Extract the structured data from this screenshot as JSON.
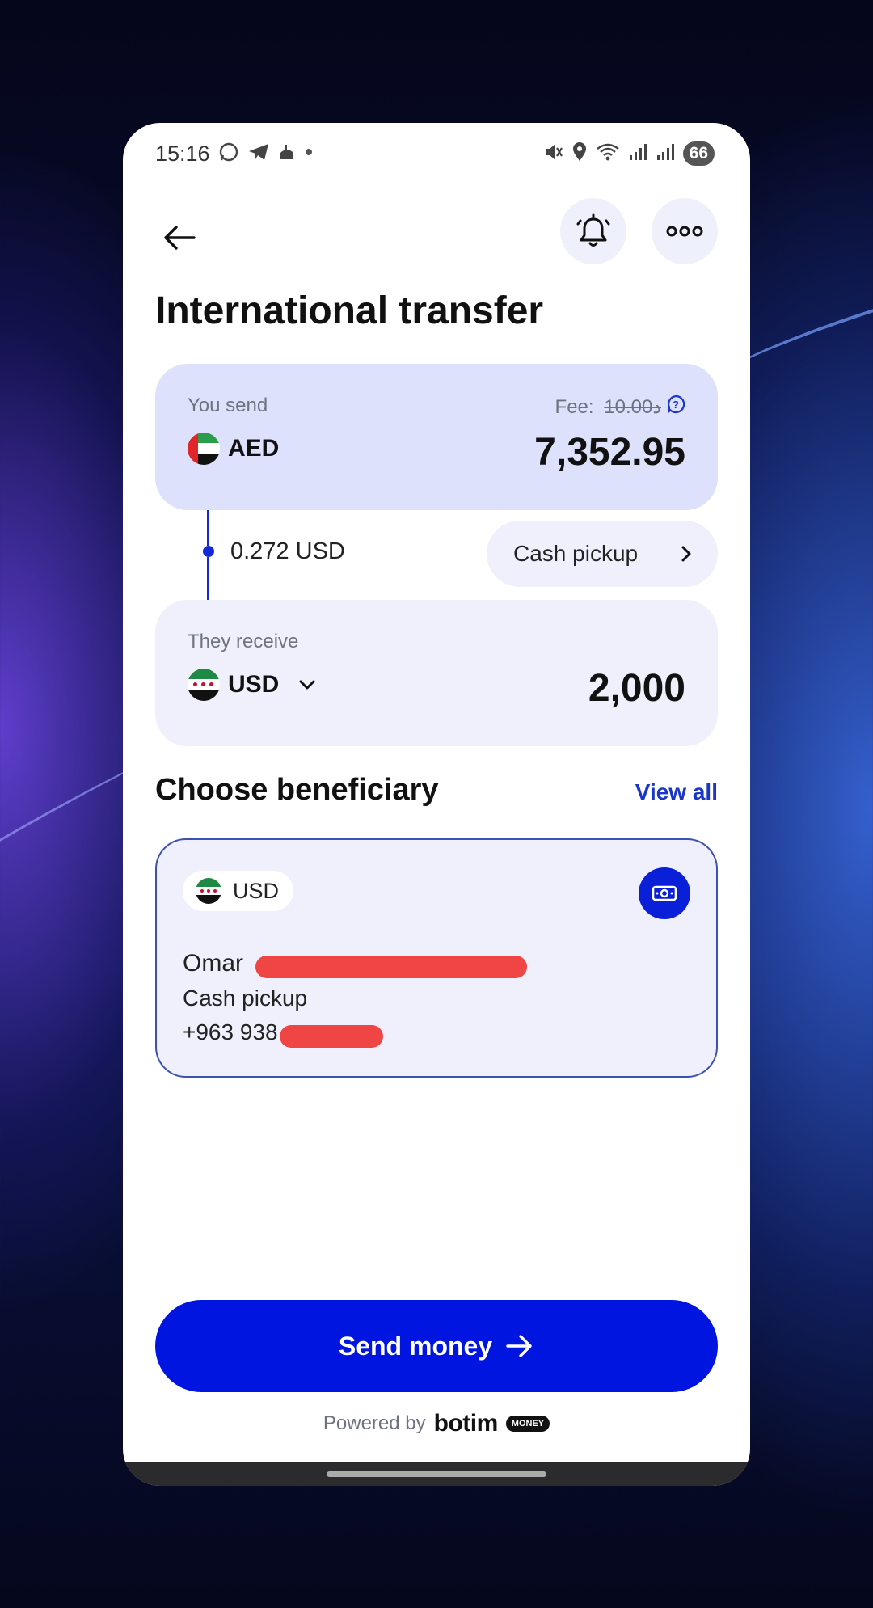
{
  "status_bar": {
    "time": "15:16",
    "battery": "66"
  },
  "header": {
    "title": "International transfer"
  },
  "send": {
    "label": "You send",
    "fee_prefix": "Fee: ",
    "fee": "د10.00",
    "currency": "AED",
    "amount": "7,352.95"
  },
  "rate": {
    "text": "0.272 USD",
    "delivery_method": "Cash pickup"
  },
  "receive": {
    "label": "They receive",
    "currency": "USD",
    "amount": "2,000"
  },
  "beneficiary_section": {
    "title": "Choose beneficiary",
    "view_all": "View all"
  },
  "beneficiary": {
    "currency": "USD",
    "name": "Omar",
    "method": "Cash pickup",
    "phone": "+963 938"
  },
  "send_button": {
    "label": "Send money"
  },
  "footer": {
    "powered_by": "Powered by",
    "brand": "botim",
    "badge": "MONEY"
  },
  "colors": {
    "accent": "#0016e0",
    "send_card": "#dde1fb",
    "receive_card": "#eff0fc",
    "link": "#1a35c9"
  }
}
